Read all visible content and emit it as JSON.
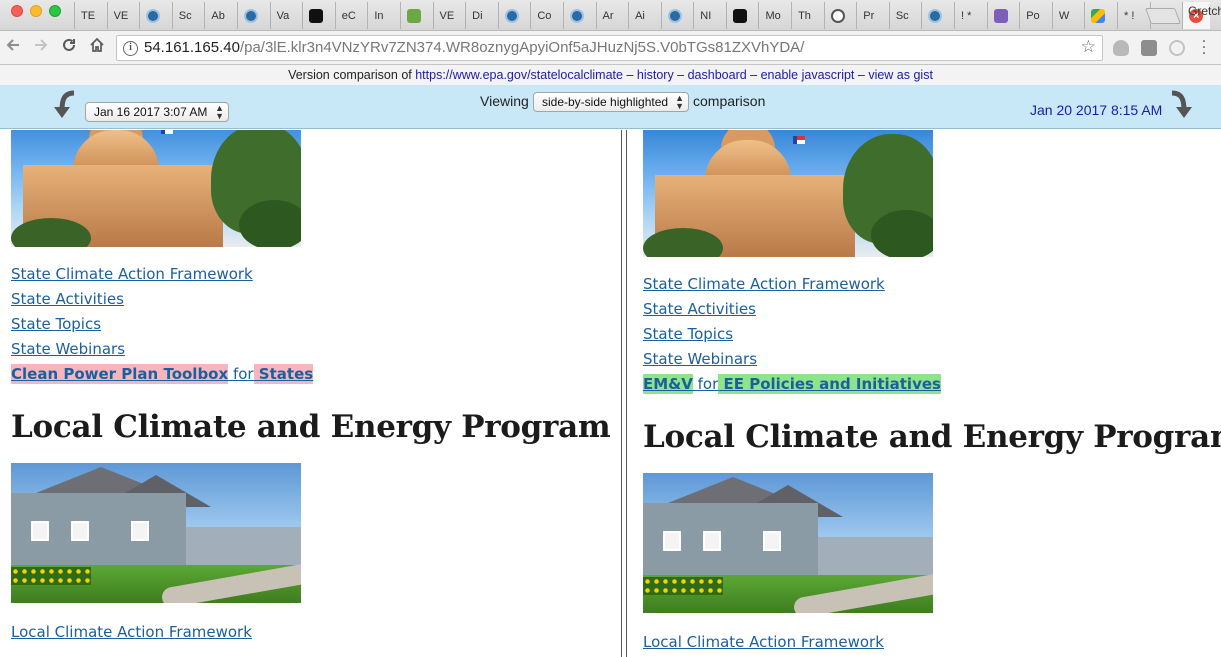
{
  "browser": {
    "tabs": [
      {
        "label": "TE",
        "icon": "page-icon"
      },
      {
        "label": "VE",
        "icon": "page-icon"
      },
      {
        "label": "",
        "icon": "epa-seal-icon"
      },
      {
        "label": "Sc",
        "icon": "page-icon"
      },
      {
        "label": "Ab",
        "icon": "page-icon"
      },
      {
        "label": "",
        "icon": "epa-seal-icon"
      },
      {
        "label": "Va",
        "icon": "page-icon"
      },
      {
        "label": "",
        "icon": "pl-icon"
      },
      {
        "label": "eC",
        "icon": "page-icon"
      },
      {
        "label": "In",
        "icon": "page-icon"
      },
      {
        "label": "",
        "icon": "nc-icon"
      },
      {
        "label": "VE",
        "icon": "page-icon"
      },
      {
        "label": "Di",
        "icon": "page-icon"
      },
      {
        "label": "",
        "icon": "epa-seal-icon"
      },
      {
        "label": "Co",
        "icon": "page-icon"
      },
      {
        "label": "",
        "icon": "epa-seal-icon"
      },
      {
        "label": "Ar",
        "icon": "page-icon"
      },
      {
        "label": "Ai",
        "icon": "page-icon"
      },
      {
        "label": "",
        "icon": "epa-seal-icon"
      },
      {
        "label": "NI",
        "icon": "page-icon"
      },
      {
        "label": "",
        "icon": "pl-icon"
      },
      {
        "label": "Mo",
        "icon": "page-icon"
      },
      {
        "label": "Th",
        "icon": "page-icon"
      },
      {
        "label": "",
        "icon": "gear-icon"
      },
      {
        "label": "Pr",
        "icon": "page-icon"
      },
      {
        "label": "Sc",
        "icon": "page-icon"
      },
      {
        "label": "",
        "icon": "epa-seal-icon"
      },
      {
        "label": "! *",
        "icon": "page-icon"
      },
      {
        "label": "",
        "icon": "m-icon"
      },
      {
        "label": "Po",
        "icon": "page-icon"
      },
      {
        "label": "W",
        "icon": "page-icon"
      },
      {
        "label": "",
        "icon": "maps-icon"
      },
      {
        "label": "* !",
        "icon": "page-icon"
      },
      {
        "label": "",
        "icon": "v-icon"
      }
    ],
    "profile_name": "Gretch",
    "url_host": "54.161.165.40",
    "url_path": "/pa/3lE.klr3n4VNzYRv7ZN374.WR8oznygApyiOnf5aJHuzNj5S.V0bTGs81ZXVhYDA/"
  },
  "compare_header": {
    "prefix": "Version comparison of ",
    "target_url": "https://www.epa.gov/statelocalclimate",
    "sep1": " – ",
    "history": "history",
    "sep2": " – ",
    "dashboard": "dashboard",
    "sep3": " – ",
    "enable_js": "enable javascript",
    "sep4": " – ",
    "gist": "view as gist",
    "viewing_label": "Viewing",
    "mode_value": "side-by-side highlighted",
    "comparison_label": "comparison",
    "left_version": "Jan 16 2017 3:07 AM",
    "right_version": "Jan 20 2017 8:15 AM"
  },
  "left_pane": {
    "links": [
      "State Climate Action Framework",
      "State Activities",
      "State Topics",
      "State Webinars"
    ],
    "changed_a": "Clean Power Plan Toolbox",
    "for_word": " for",
    "changed_b": " States",
    "heading": "Local Climate and Energy Program",
    "bottom_link": "Local Climate Action Framework"
  },
  "right_pane": {
    "links": [
      "State Climate Action Framework",
      "State Activities",
      "State Topics",
      "State Webinars"
    ],
    "changed_a": "EM&V",
    "for_word": " for",
    "changed_b": " EE Policies and Initiatives",
    "heading": "Local Climate and Energy Program",
    "bottom_link": "Local Climate Action Framework"
  },
  "colors": {
    "deletion_highlight": "#f7b5be",
    "insertion_highlight": "#8fe38a",
    "link": "#1a5f9e",
    "nav_bar": "#c8e8f8"
  }
}
